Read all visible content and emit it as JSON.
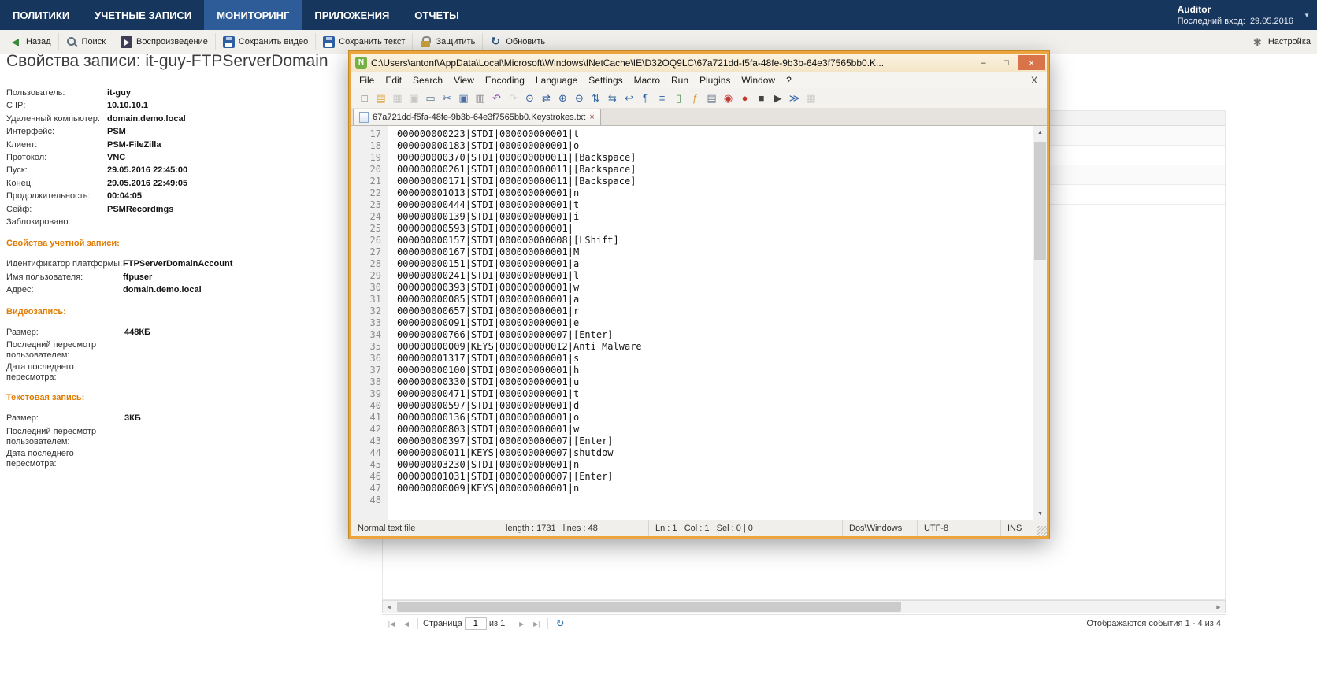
{
  "nav": {
    "items": [
      {
        "name": "nav-policies",
        "label": "ПОЛИТИКИ"
      },
      {
        "name": "nav-accounts",
        "label": "УЧЕТНЫЕ ЗАПИСИ"
      },
      {
        "name": "nav-monitoring",
        "label": "МОНИТОРИНГ",
        "active": true
      },
      {
        "name": "nav-applications",
        "label": "ПРИЛОЖЕНИЯ"
      },
      {
        "name": "nav-reports",
        "label": "ОТЧЕТЫ"
      }
    ],
    "user": {
      "name": "Auditor",
      "last_login_label": "Последний вход:",
      "last_login_value": "29.05.2016"
    }
  },
  "toolbar": {
    "buttons": [
      {
        "name": "back-button",
        "icon": "back",
        "label": "Назад"
      },
      {
        "name": "search-button",
        "icon": "search",
        "label": "Поиск"
      },
      {
        "name": "playback-button",
        "icon": "playback",
        "label": "Воспроизведение"
      },
      {
        "name": "save-video-button",
        "icon": "save",
        "label": "Сохранить видео"
      },
      {
        "name": "save-text-button",
        "icon": "save",
        "label": "Сохранить текст"
      },
      {
        "name": "protect-button",
        "icon": "protect",
        "label": "Защитить"
      },
      {
        "name": "refresh-button",
        "icon": "refresh",
        "label": "Обновить"
      }
    ],
    "settings_label": "Настройка"
  },
  "page": {
    "title": "Свойства записи: it-guy-FTPServerDomain"
  },
  "properties": {
    "sections": [
      {
        "rows": [
          {
            "label": "Пользователь:",
            "value": "it-guy"
          },
          {
            "label": "С IP:",
            "value": "10.10.10.1"
          },
          {
            "label": "Удаленный компьютер:",
            "value": "domain.demo.local"
          },
          {
            "label": "Интерфейс:",
            "value": "PSM"
          },
          {
            "label": "Клиент:",
            "value": "PSM-FileZilla"
          },
          {
            "label": "Протокол:",
            "value": "VNC"
          },
          {
            "label": "Пуск:",
            "value": "29.05.2016 22:45:00"
          },
          {
            "label": "Конец:",
            "value": "29.05.2016 22:49:05"
          },
          {
            "label": "Продолжительность:",
            "value": "00:04:05"
          },
          {
            "label": "Сейф:",
            "value": "PSMRecordings"
          },
          {
            "label": "Заблокировано:",
            "value": ""
          }
        ]
      },
      {
        "header": "Свойства учетной записи:",
        "rows": [
          {
            "label": "Идентификатор платформы:",
            "value": "FTPServerDomainAccount"
          },
          {
            "label": "Имя пользователя:",
            "value": "ftpuser"
          },
          {
            "label": "Адрес:",
            "value": "domain.demo.local"
          }
        ]
      },
      {
        "header": "Видеозапись:",
        "rows": [
          {
            "label": "Размер:",
            "value": "448КБ"
          },
          {
            "label": "Последний пересмотр пользователем:",
            "value": ""
          },
          {
            "label": "Дата последнего пересмотра:",
            "value": ""
          }
        ]
      },
      {
        "header": "Текстовая запись:",
        "rows": [
          {
            "label": "Размер:",
            "value": "3КБ"
          },
          {
            "label": "Последний пересмотр пользователем:",
            "value": ""
          },
          {
            "label": "Дата последнего пересмотра:",
            "value": ""
          }
        ]
      }
    ]
  },
  "events_grid": {
    "pagination": {
      "first_icon": "|◀",
      "prev_icon": "◀",
      "page_label": "Страница",
      "page_value": "1",
      "of_label": "из 1",
      "next_icon": "▶",
      "last_icon": "▶|",
      "refresh_icon": "↻"
    },
    "status_text": "Отображаются события 1 - 4 из 4"
  },
  "icons": {
    "scroll_up": "▲",
    "scroll_down": "▼",
    "scroll_left": "◀",
    "scroll_right": "▶",
    "user_caret": "▼"
  },
  "notepad": {
    "title": "C:\\Users\\antonf\\AppData\\Local\\Microsoft\\Windows\\INetCache\\IE\\D32OQ9LC\\67a721dd-f5fa-48fe-9b3b-64e3f7565bb0.K...",
    "app_icon_letter": "N",
    "controls": {
      "minimize": "–",
      "maximize": "□",
      "close": "×"
    },
    "menu": [
      "File",
      "Edit",
      "Search",
      "View",
      "Encoding",
      "Language",
      "Settings",
      "Macro",
      "Run",
      "Plugins",
      "Window",
      "?"
    ],
    "menu_close": "X",
    "toolbar_icons": [
      {
        "name": "new-file-icon",
        "glyph": "□",
        "color": "#7a7a7a"
      },
      {
        "name": "open-folder-icon",
        "glyph": "▤",
        "color": "#d9a33c"
      },
      {
        "name": "save-icon",
        "glyph": "▦",
        "color": "#7a7a7a",
        "disabled": true
      },
      {
        "name": "save-all-icon",
        "glyph": "▣",
        "color": "#7a7a7a",
        "disabled": true
      },
      {
        "name": "print-icon",
        "glyph": "▭",
        "color": "#5f7d95"
      },
      {
        "name": "cut-icon",
        "glyph": "✂",
        "color": "#4a6fa5"
      },
      {
        "name": "copy-icon",
        "glyph": "▣",
        "color": "#4a6fa5"
      },
      {
        "name": "paste-icon",
        "glyph": "▥",
        "color": "#8a8a8a"
      },
      {
        "name": "undo-icon",
        "glyph": "↶",
        "color": "#7a3fa0"
      },
      {
        "name": "redo-icon",
        "glyph": "↷",
        "color": "#9a9a9a",
        "disabled": true
      },
      {
        "name": "find-icon",
        "glyph": "⊙",
        "color": "#2f5fa3"
      },
      {
        "name": "replace-icon",
        "glyph": "⇄",
        "color": "#2f5fa3"
      },
      {
        "name": "zoom-in-icon",
        "glyph": "⊕",
        "color": "#2f5fa3"
      },
      {
        "name": "zoom-out-icon",
        "glyph": "⊖",
        "color": "#2f5fa3"
      },
      {
        "name": "sync-vertical-icon",
        "glyph": "⇅",
        "color": "#3a6ea5"
      },
      {
        "name": "sync-horizontal-icon",
        "glyph": "⇆",
        "color": "#3a6ea5"
      },
      {
        "name": "word-wrap-icon",
        "glyph": "↩",
        "color": "#3a6ea5"
      },
      {
        "name": "show-all-characters-icon",
        "glyph": "¶",
        "color": "#2f5fa3"
      },
      {
        "name": "indent-guide-icon",
        "glyph": "≡",
        "color": "#2f5fa3"
      },
      {
        "name": "document-map-icon",
        "glyph": "▯",
        "color": "#4f8f4f"
      },
      {
        "name": "function-list-icon",
        "glyph": "ƒ",
        "color": "#d9a33c"
      },
      {
        "name": "folder-workspace-icon",
        "glyph": "▤",
        "color": "#6b7b8c"
      },
      {
        "name": "document-monitor-icon",
        "glyph": "◉",
        "color": "#c23b3b"
      },
      {
        "name": "macro-record-icon",
        "glyph": "●",
        "color": "#c0392b"
      },
      {
        "name": "macro-stop-icon",
        "glyph": "■",
        "color": "#444444"
      },
      {
        "name": "macro-play-icon",
        "glyph": "▶",
        "color": "#444444"
      },
      {
        "name": "macro-run-multiple-icon",
        "glyph": "≫",
        "color": "#2f5fa3"
      },
      {
        "name": "macro-save-icon",
        "glyph": "▦",
        "color": "#8a8a8a",
        "disabled": true
      }
    ],
    "tab": {
      "label": "67a721dd-f5fa-48fe-9b3b-64e3f7565bb0.Keystrokes.txt",
      "close_icon": "×"
    },
    "lines": [
      {
        "n": "17",
        "t": "000000000223|STDI|000000000001|t"
      },
      {
        "n": "18",
        "t": "000000000183|STDI|000000000001|o"
      },
      {
        "n": "19",
        "t": "000000000370|STDI|000000000011|[Backspace]"
      },
      {
        "n": "20",
        "t": "000000000261|STDI|000000000011|[Backspace]"
      },
      {
        "n": "21",
        "t": "000000000171|STDI|000000000011|[Backspace]"
      },
      {
        "n": "22",
        "t": "000000001013|STDI|000000000001|n"
      },
      {
        "n": "23",
        "t": "000000000444|STDI|000000000001|t"
      },
      {
        "n": "24",
        "t": "000000000139|STDI|000000000001|i"
      },
      {
        "n": "25",
        "t": "000000000593|STDI|000000000001| "
      },
      {
        "n": "26",
        "t": "000000000157|STDI|000000000008|[LShift]"
      },
      {
        "n": "27",
        "t": "000000000167|STDI|000000000001|M"
      },
      {
        "n": "28",
        "t": "000000000151|STDI|000000000001|a"
      },
      {
        "n": "29",
        "t": "000000000241|STDI|000000000001|l"
      },
      {
        "n": "30",
        "t": "000000000393|STDI|000000000001|w"
      },
      {
        "n": "31",
        "t": "000000000085|STDI|000000000001|a"
      },
      {
        "n": "32",
        "t": "000000000657|STDI|000000000001|r"
      },
      {
        "n": "33",
        "t": "000000000091|STDI|000000000001|e"
      },
      {
        "n": "34",
        "t": "000000000766|STDI|000000000007|[Enter]"
      },
      {
        "n": "35",
        "t": "000000000009|KEYS|000000000012|Anti Malware"
      },
      {
        "n": "36",
        "t": "000000001317|STDI|000000000001|s"
      },
      {
        "n": "37",
        "t": "000000000100|STDI|000000000001|h"
      },
      {
        "n": "38",
        "t": "000000000330|STDI|000000000001|u"
      },
      {
        "n": "39",
        "t": "000000000471|STDI|000000000001|t"
      },
      {
        "n": "40",
        "t": "000000000597|STDI|000000000001|d"
      },
      {
        "n": "41",
        "t": "000000000136|STDI|000000000001|o"
      },
      {
        "n": "42",
        "t": "000000000803|STDI|000000000001|w"
      },
      {
        "n": "43",
        "t": "000000000397|STDI|000000000007|[Enter]"
      },
      {
        "n": "44",
        "t": "000000000011|KEYS|000000000007|shutdow"
      },
      {
        "n": "45",
        "t": "000000003230|STDI|000000000001|n"
      },
      {
        "n": "46",
        "t": "000000001031|STDI|000000000007|[Enter]"
      },
      {
        "n": "47",
        "t": "000000000009|KEYS|000000000001|n"
      },
      {
        "n": "48",
        "t": ""
      }
    ],
    "status": {
      "doc_type": "Normal text file",
      "length_lines": "length : 1731   lines : 48",
      "caret": "Ln : 1   Col : 1   Sel : 0 | 0",
      "eol": "Dos\\Windows",
      "encoding": "UTF-8",
      "insert_mode": "INS"
    }
  }
}
